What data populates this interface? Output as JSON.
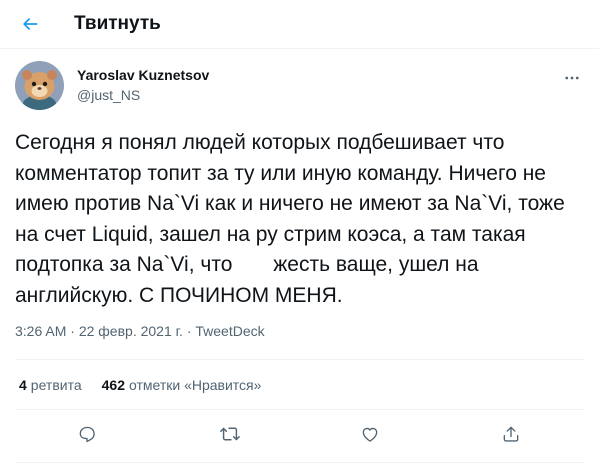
{
  "header": {
    "title": "Твитнуть",
    "back_icon": "arrow-left-icon",
    "accent_color": "#1d9bf0"
  },
  "user": {
    "name": "Yaroslav Kuznetsov",
    "handle": "@just_NS",
    "avatar_icon": "hamster-avatar"
  },
  "tweet": {
    "text": "Сегодня я понял людей которых подбешивает что комментатор топит за ту или иную команду. Ничего не имею против Na`Vi как и ничего не имеют за Na`Vi, тоже на счет Liquid, зашел на ру стрим коэса, а там такая подтопка за Na`Vi, что       жесть ваще, ушел на английскую. С ПОЧИНОМ МЕНЯ.",
    "time": "3:26 AM",
    "separator": "·",
    "date": "22 февр. 2021 г.",
    "source": "TweetDeck"
  },
  "stats": {
    "retweets_count": "4",
    "retweets_label": "ретвита",
    "likes_count": "462",
    "likes_label": "отметки «Нравится»"
  },
  "actions": [
    {
      "name": "reply-icon"
    },
    {
      "name": "retweet-icon"
    },
    {
      "name": "like-icon"
    },
    {
      "name": "share-icon"
    }
  ]
}
